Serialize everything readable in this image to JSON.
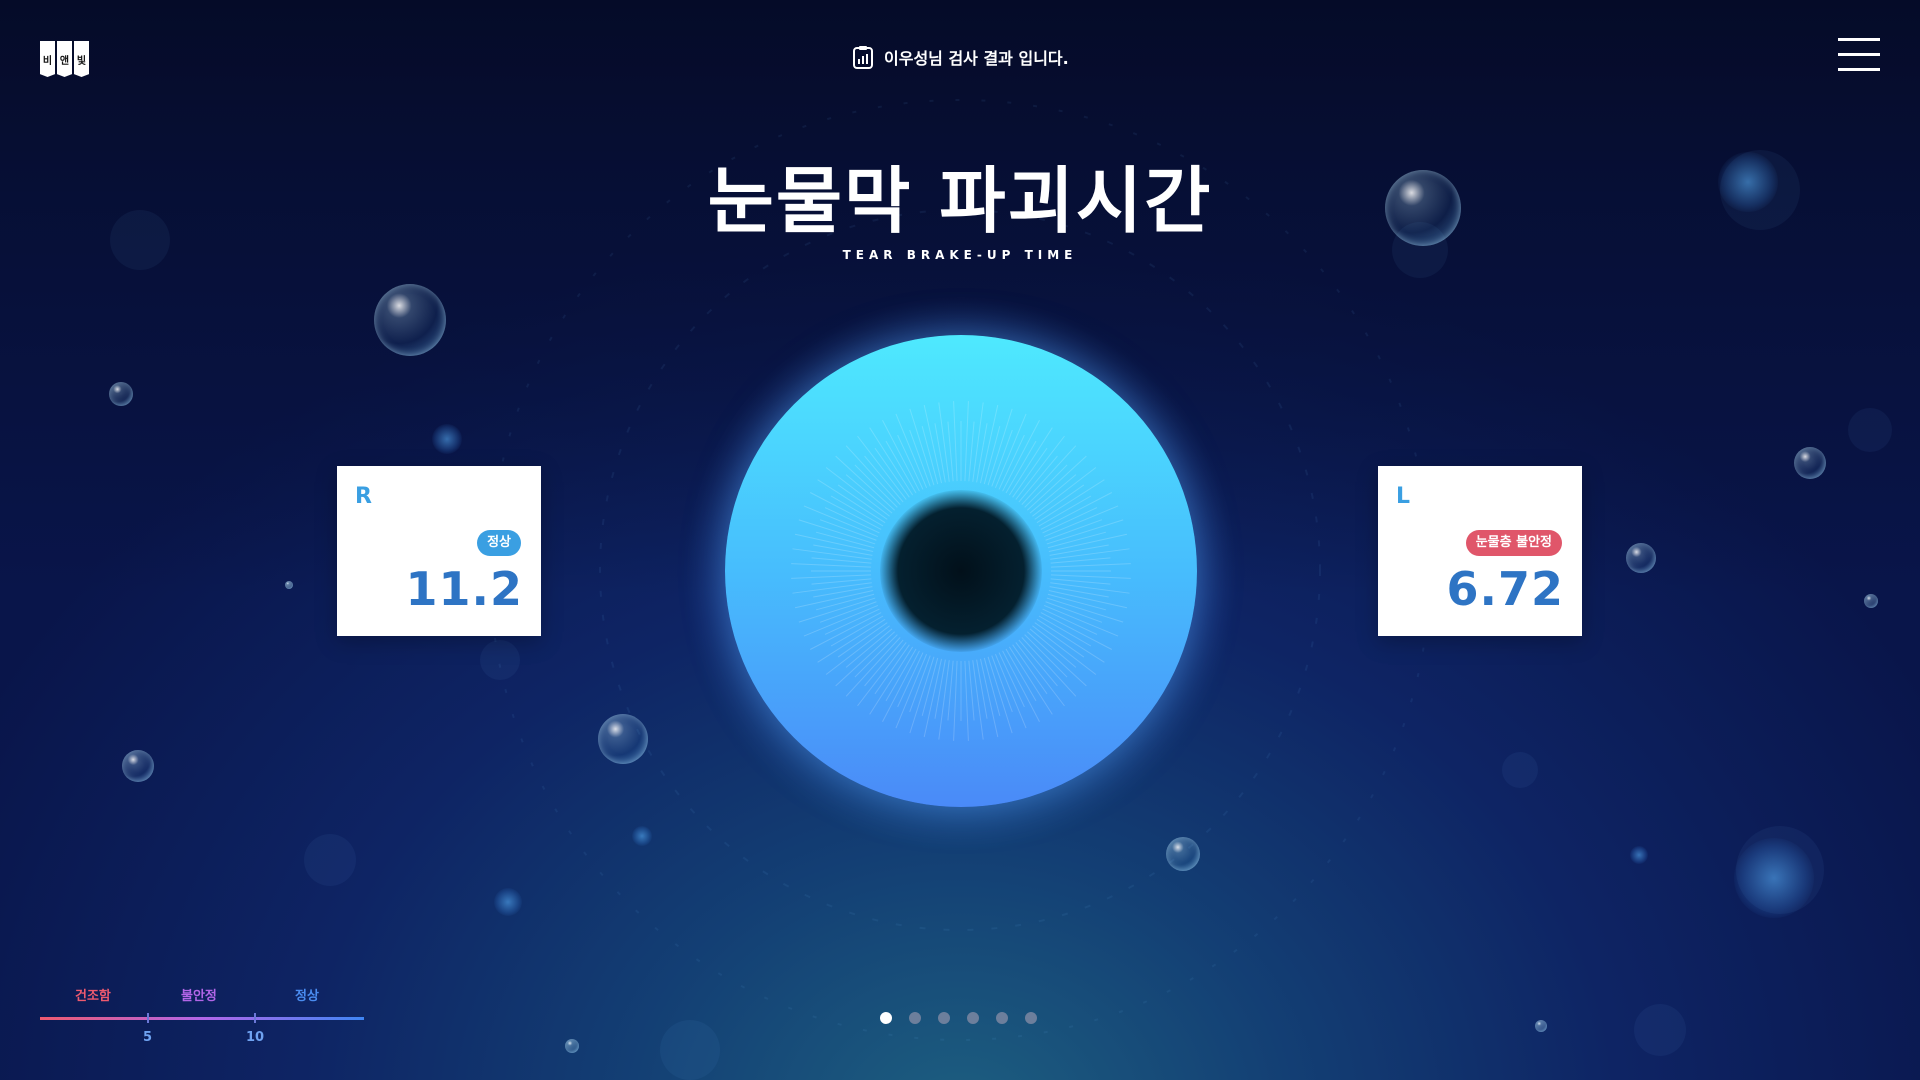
{
  "logo": {
    "chars": [
      "비",
      "앤",
      "빛"
    ]
  },
  "header": {
    "title": "이우성님 검사 결과 입니다.",
    "title_icon": "clipboard-chart-icon",
    "menu_icon": "hamburger-menu-icon"
  },
  "main": {
    "title": "눈물막 파괴시간",
    "subtitle": "TEAR BRAKE-UP TIME"
  },
  "right_eye": {
    "side": "R",
    "status": "정상",
    "status_color": "#3a9fe2",
    "value": "11.2"
  },
  "left_eye": {
    "side": "L",
    "status": "눈물층 불안정",
    "status_color": "#e0566a",
    "value": "6.72"
  },
  "legend": {
    "labels": [
      {
        "text": "건조함",
        "color": "#ee5a6f"
      },
      {
        "text": "불안정",
        "color": "#b266e8"
      },
      {
        "text": "정상",
        "color": "#4a8cf0"
      }
    ],
    "ticks": [
      "5",
      "10"
    ]
  },
  "pager": {
    "total": 6,
    "active": 1
  },
  "colors": {
    "accent": "#3a9fe2",
    "value_text": "#2e74c4",
    "background": "#0b1a55"
  }
}
